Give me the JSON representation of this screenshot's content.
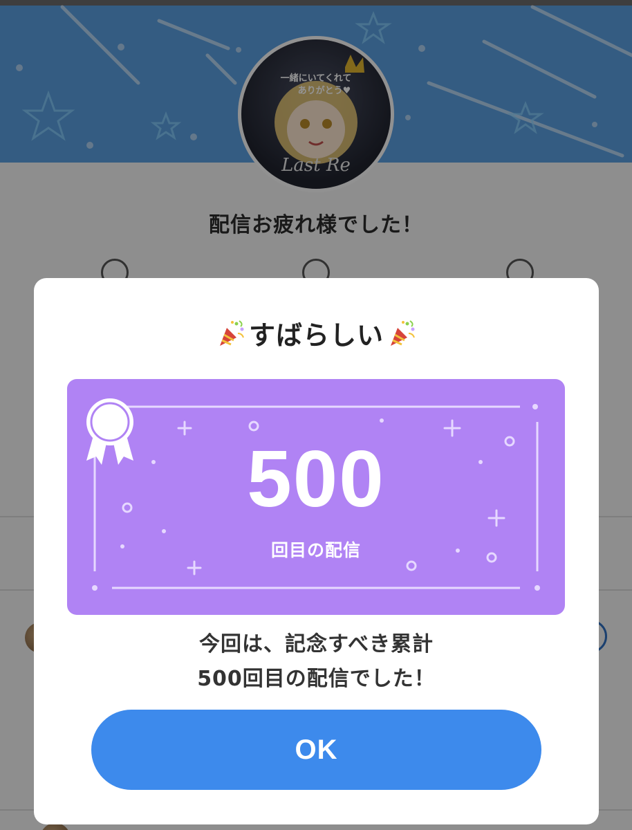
{
  "background_page": {
    "title": "配信お疲れ様でした！",
    "avatar_text_line1": "一緒にいてくれて",
    "avatar_text_line2": "ありがとう♥",
    "avatar_signature": "Last Re"
  },
  "dialog": {
    "title": "すばらしい",
    "title_icon": "party-popper-icon",
    "milestone_number": "500",
    "milestone_caption": "回目の配信",
    "milestone_icon": "medal-ribbon-icon",
    "message_line1": "今回は、記念すべき累計",
    "message_line2": "500回目の配信でした！",
    "ok_label": "OK"
  },
  "colors": {
    "banner": "#5a9fe0",
    "card": "#b083f4",
    "button": "#3d8aec"
  }
}
